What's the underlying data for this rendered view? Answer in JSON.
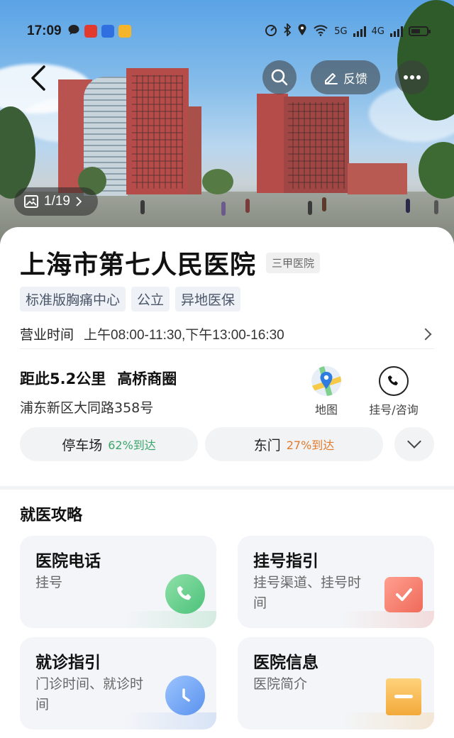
{
  "status_bar": {
    "time": "17:09",
    "network_labels": [
      "5G",
      "4G"
    ]
  },
  "nav": {
    "back_icon": "chevron-left-icon",
    "search_icon": "search-icon",
    "feedback_label": "反馈",
    "more_icon": "more-icon"
  },
  "photo": {
    "counter": "1/19"
  },
  "hospital": {
    "name": "上海市第七人民医院",
    "grade": "三甲医院",
    "tags": [
      "标准版胸痛中心",
      "公立",
      "异地医保"
    ],
    "hours_label": "营业时间",
    "hours_value": "上午08:00-11:30,下午13:00-16:30",
    "distance": "距此5.2公里",
    "district": "高桥商圈",
    "address": "浦东新区大同路358号",
    "actions": {
      "map_label": "地图",
      "call_label": "挂号/咨询"
    },
    "entrances": [
      {
        "name": "停车场",
        "pct": "62%到达",
        "color": "#3aa66a"
      },
      {
        "name": "东门",
        "pct": "27%到达",
        "color": "#e07b2e"
      }
    ]
  },
  "guide": {
    "title": "就医攻略",
    "cards": [
      {
        "title": "医院电话",
        "subtitle": "挂号",
        "icon": "phone-icon",
        "accent": "#4cc27a"
      },
      {
        "title": "挂号指引",
        "subtitle": "挂号渠道、挂号时间",
        "icon": "calendar-check-icon",
        "accent": "#ef6a5a"
      },
      {
        "title": "就诊指引",
        "subtitle": "门诊时间、就诊时间",
        "icon": "clock-icon",
        "accent": "#5a92ee"
      },
      {
        "title": "医院信息",
        "subtitle": "医院简介",
        "icon": "info-card-icon",
        "accent": "#f2a93b"
      }
    ]
  }
}
